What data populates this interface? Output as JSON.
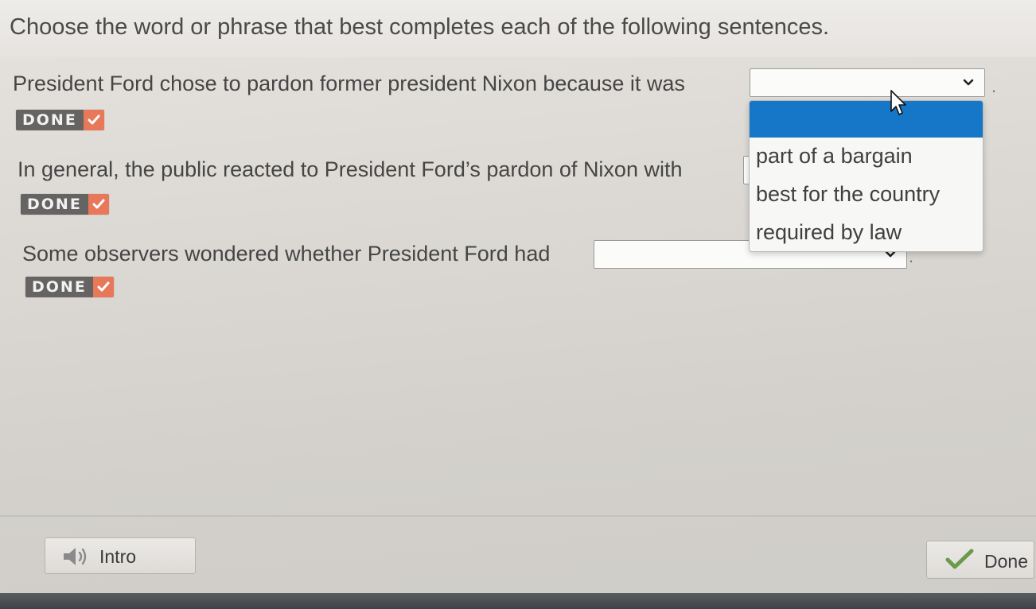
{
  "instructions": "Choose the word or phrase that best completes each of the following sentences.",
  "questions": [
    {
      "text": "President Ford chose to pardon former president Nixon because it was",
      "selected_value": "",
      "trailing": ".",
      "badge_label": "DONE"
    },
    {
      "text": "In general, the public reacted to President Ford’s pardon of Nixon with",
      "selected_value": "",
      "trailing": "",
      "badge_label": "DONE"
    },
    {
      "text": "Some observers wondered whether President Ford had",
      "selected_value": "",
      "trailing": ".",
      "badge_label": "DONE"
    }
  ],
  "dropdown": {
    "options": [
      "",
      "part of a bargain",
      "best for the country",
      "required by law"
    ],
    "highlighted_index": 0
  },
  "footer": {
    "intro_label": "Intro",
    "done_label": "Done"
  },
  "colors": {
    "highlight": "#1676c7",
    "badge_check": "#e8785a",
    "badge_bg": "#666462"
  },
  "icons": {
    "intro": "speaker-icon",
    "done": "checkmark-icon",
    "select": "chevron-down-icon"
  }
}
